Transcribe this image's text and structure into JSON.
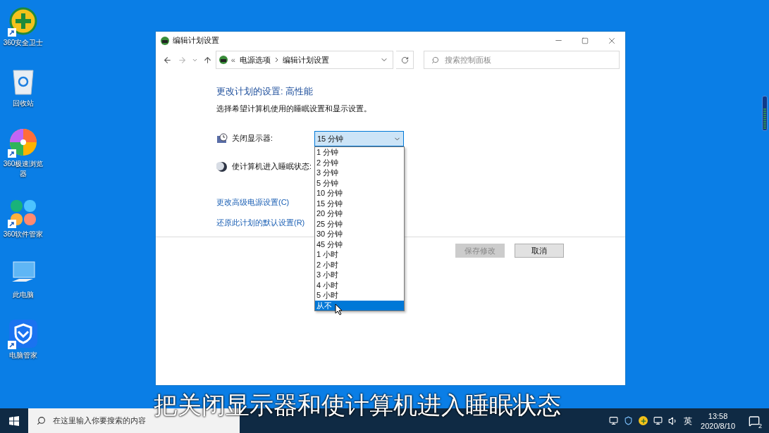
{
  "desktop_icons": [
    {
      "label": "360安全卫士",
      "kind": "guard",
      "shortcut": true
    },
    {
      "label": "回收站",
      "kind": "bin",
      "shortcut": false
    },
    {
      "label": "360极速浏览器",
      "kind": "browser",
      "shortcut": true
    },
    {
      "label": "360软件管家",
      "kind": "store",
      "shortcut": true
    },
    {
      "label": "此电脑",
      "kind": "pc",
      "shortcut": false
    },
    {
      "label": "电脑管家",
      "kind": "shield",
      "shortcut": true
    }
  ],
  "window": {
    "title": "编辑计划设置",
    "address": {
      "prefix": "«",
      "crumbs": [
        "电源选项",
        "编辑计划设置"
      ]
    },
    "search": {
      "placeholder": "搜索控制面板"
    },
    "heading": "更改计划的设置: 高性能",
    "description": "选择希望计算机使用的睡眠设置和显示设置。",
    "settings": [
      {
        "label": "关闭显示器:",
        "kind": "display",
        "value": "15 分钟",
        "expanded": true
      },
      {
        "label": "使计算机进入睡眠状态:",
        "kind": "sleep"
      }
    ],
    "links": [
      "更改高级电源设置(C)",
      "还原此计划的默认设置(R)"
    ],
    "buttons": [
      {
        "label": "保存修改",
        "disabled": true
      },
      {
        "label": "取消",
        "disabled": false
      }
    ],
    "dropdown_options": [
      {
        "label": "1 分钟",
        "selected": false
      },
      {
        "label": "2 分钟",
        "selected": false
      },
      {
        "label": "3 分钟",
        "selected": false
      },
      {
        "label": "5 分钟",
        "selected": false
      },
      {
        "label": "10 分钟",
        "selected": false
      },
      {
        "label": "15 分钟",
        "selected": false
      },
      {
        "label": "20 分钟",
        "selected": false
      },
      {
        "label": "25 分钟",
        "selected": false
      },
      {
        "label": "30 分钟",
        "selected": false
      },
      {
        "label": "45 分钟",
        "selected": false
      },
      {
        "label": "1 小时",
        "selected": false
      },
      {
        "label": "2 小时",
        "selected": false
      },
      {
        "label": "3 小时",
        "selected": false
      },
      {
        "label": "4 小时",
        "selected": false
      },
      {
        "label": "5 小时",
        "selected": false
      },
      {
        "label": "从不",
        "selected": true
      }
    ]
  },
  "subtitle": "把关闭显示器和使计算机进入睡眠状态",
  "taskbar": {
    "search": {
      "placeholder": "在这里输入你要搜索的内容"
    },
    "language": "英",
    "time": "13:58",
    "date": "2020/8/10",
    "notifications": "2"
  }
}
